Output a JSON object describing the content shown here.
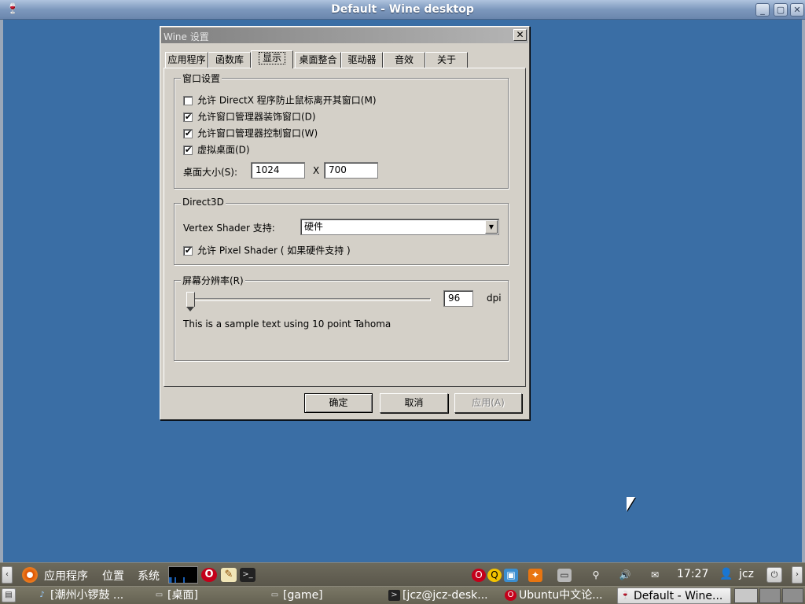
{
  "outer_window": {
    "title": "Default - Wine desktop",
    "min_icon": "_",
    "max_icon": "▢",
    "close_icon": "✕"
  },
  "dialog": {
    "title": "Wine 设置",
    "close_label": "✕",
    "tabs": [
      {
        "label": "应用程序"
      },
      {
        "label": "函数库"
      },
      {
        "label": "显示",
        "active": true
      },
      {
        "label": "桌面整合"
      },
      {
        "label": "驱动器"
      },
      {
        "label": "音效"
      },
      {
        "label": "关于"
      }
    ],
    "window_group": {
      "title": "窗口设置",
      "options": [
        {
          "label": "允许 DirectX 程序防止鼠标离开其窗口(M)",
          "checked": false
        },
        {
          "label": "允许窗口管理器装饰窗口(D)",
          "checked": true
        },
        {
          "label": "允许窗口管理器控制窗口(W)",
          "checked": true
        },
        {
          "label": "虚拟桌面(D)",
          "checked": true
        }
      ],
      "desktop_size_label": "桌面大小(S):",
      "width": "1024",
      "x_separator": "X",
      "height": "700"
    },
    "d3d_group": {
      "title": "Direct3D",
      "vertex_label": "Vertex Shader 支持:",
      "vertex_value": "硬件",
      "pixel_shader_label": "允许 Pixel Shader ( 如果硬件支持 )",
      "pixel_shader_checked": true
    },
    "dpi_group": {
      "title": "屏幕分辨率(R)",
      "dpi_value": "96",
      "dpi_unit": "dpi",
      "slider_level_fraction": 0.0,
      "sample_text": "This is a sample text using 10 point Tahoma"
    },
    "buttons": {
      "ok": "确定",
      "cancel": "取消",
      "apply": "应用(A)"
    }
  },
  "top_panel": {
    "apps_menu": "应用程序",
    "places_menu": "位置",
    "system_menu": "系统",
    "clock": "17:27",
    "user": "jcz"
  },
  "taskbar": {
    "tasks": [
      {
        "label": "[潮州小锣鼓 ..."
      },
      {
        "label": "[桌面]"
      },
      {
        "label": "[game]"
      },
      {
        "label": "[jcz@jcz-desk..."
      },
      {
        "label": "Ubuntu中文论..."
      },
      {
        "label": "Default - Wine..."
      }
    ]
  },
  "colors": {
    "desktop": "#3a6ea5",
    "dialog_face": "#d4d0c8"
  }
}
